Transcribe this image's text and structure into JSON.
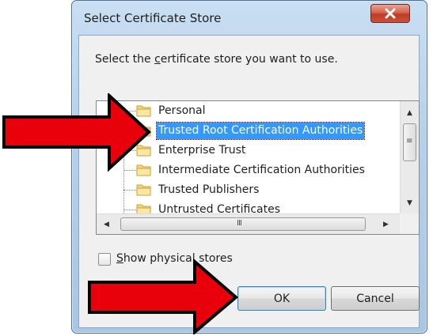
{
  "window": {
    "title": "Select Certificate Store"
  },
  "instruction": {
    "pre": "Select the ",
    "accel": "c",
    "post": "ertificate store you want to use."
  },
  "stores": [
    {
      "label": "Personal",
      "selected": false
    },
    {
      "label": "Trusted Root Certification Authorities",
      "selected": true
    },
    {
      "label": "Enterprise Trust",
      "selected": false
    },
    {
      "label": "Intermediate Certification Authorities",
      "selected": false
    },
    {
      "label": "Trusted Publishers",
      "selected": false
    },
    {
      "label": "Untrusted Certificates",
      "selected": false
    }
  ],
  "checkbox": {
    "accel": "S",
    "rest": "how physical stores",
    "checked": false
  },
  "buttons": {
    "ok_label": "OK",
    "cancel_label": "Cancel"
  },
  "colors": {
    "selection": "#3399ff",
    "annotation_arrow": "#e8000b",
    "folder": "#f6d678"
  },
  "icons": {
    "folder": "folder-icon",
    "close": "close-icon"
  }
}
